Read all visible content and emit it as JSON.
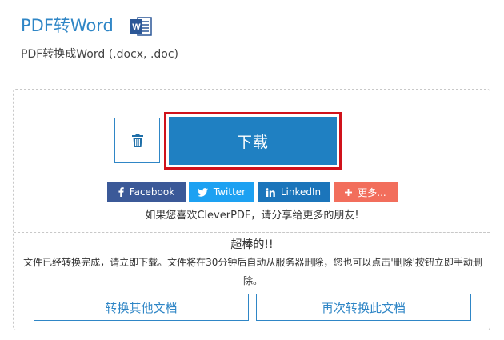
{
  "header": {
    "title": "PDF转Word",
    "subtitle": "PDF转换成Word (.docx, .doc)",
    "word_icon_letter": "W"
  },
  "actions": {
    "download_label": "下载"
  },
  "share": {
    "facebook_label": "Facebook",
    "twitter_label": "Twitter",
    "linkedin_label": "LinkedIn",
    "more_label": "更多...",
    "note": "如果您喜欢CleverPDF，请分享给更多的朋友!"
  },
  "result": {
    "title": "超棒的!!",
    "message": "文件已经转换完成，请立即下载。文件将在30分钟后自动从服务器删除，您也可以点击'删除'按钮立即手动删除。"
  },
  "buttons": {
    "convert_other": "转换其他文档",
    "convert_again": "再次转换此文档"
  },
  "colors": {
    "accent": "#2f86c6",
    "download": "#1f80c2",
    "highlight": "#d0121b",
    "facebook": "#3b5998",
    "twitter": "#1da1f2",
    "linkedin": "#1b75bb",
    "more": "#f26e5c"
  }
}
